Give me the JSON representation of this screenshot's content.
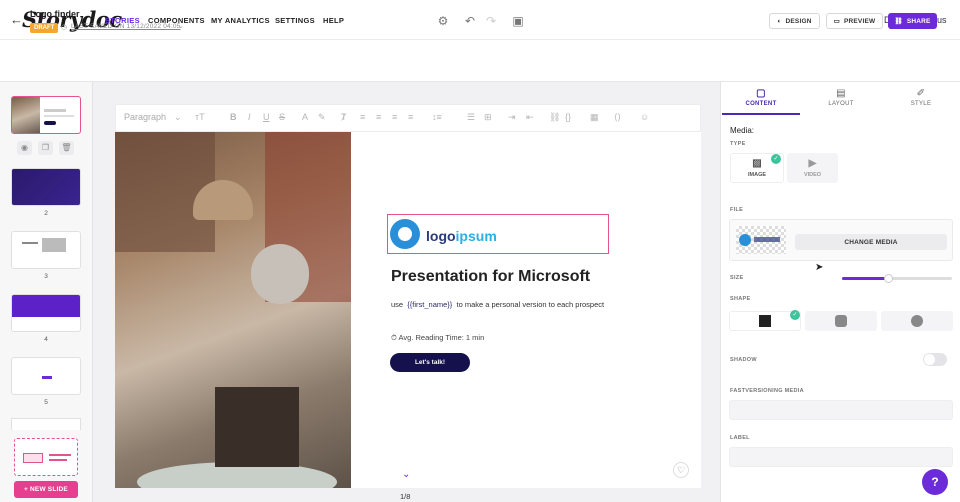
{
  "brand": {
    "logo": "Storydoc",
    "accent": "#6c2bd9"
  },
  "nav": {
    "items": [
      "STORIES",
      "COMPONENTS",
      "MY ANALYTICS",
      "SETTINGS",
      "HELP"
    ],
    "active": "STORIES",
    "user_initials": "DD",
    "user_name": "Dawid Dapszus"
  },
  "doc": {
    "title": "Logo finder",
    "status": "DRAFT",
    "last_saved": "LAST SAVED ON 13/12/2022 04:05",
    "buttons": {
      "design": "DESIGN",
      "preview": "PREVIEW",
      "share": "SHARE"
    }
  },
  "slides": {
    "numbers": [
      "2",
      "3",
      "4",
      "5"
    ],
    "new_slide": "+ NEW SLIDE"
  },
  "toolbar": {
    "paragraph": "Paragraph"
  },
  "slide": {
    "logo_word1": "logo",
    "logo_word2": "ipsum",
    "title": "Presentation for Microsoft",
    "sub_pre": "use",
    "sub_var": "{{first_name}}",
    "sub_post": "to make a personal version to each prospect",
    "reading": "Avg. Reading Time: 1 min",
    "cta": "Let's talk!",
    "pager": "1/8"
  },
  "panel": {
    "tabs": [
      "CONTENT",
      "LAYOUT",
      "STYLE"
    ],
    "active_tab": "CONTENT",
    "media_label": "Media:",
    "type_label": "TYPE",
    "type_options": [
      "IMAGE",
      "VIDEO"
    ],
    "file_label": "FILE",
    "change_media": "CHANGE MEDIA",
    "size_label": "SIZE",
    "size_value": 0.42,
    "shape_label": "SHAPE",
    "shadow_label": "SHADOW",
    "fastversioning_label": "FASTVERSIONING MEDIA",
    "label_label": "LABEL",
    "help": "?"
  }
}
